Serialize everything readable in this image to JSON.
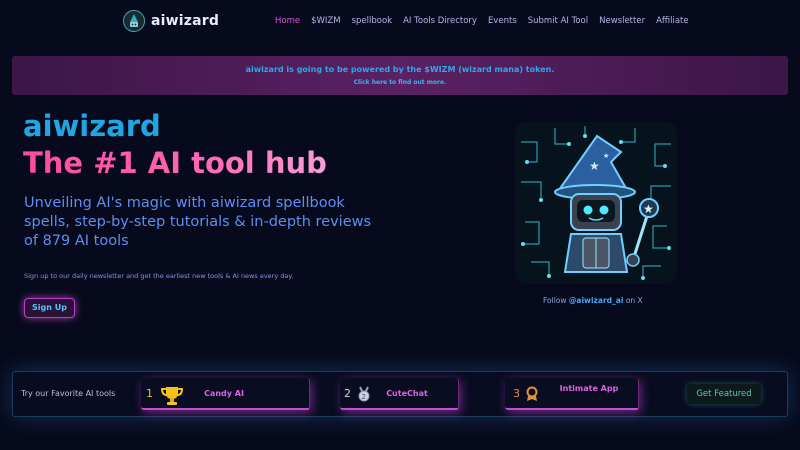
{
  "brand": {
    "name": "aiwizard"
  },
  "nav": {
    "links": [
      {
        "label": "Home",
        "active": true
      },
      {
        "label": "$WIZM",
        "active": false
      },
      {
        "label": "spellbook",
        "active": false
      },
      {
        "label": "AI Tools Directory",
        "active": false
      },
      {
        "label": "Events",
        "active": false
      },
      {
        "label": "Submit AI Tool",
        "active": false
      },
      {
        "label": "Newsletter",
        "active": false
      },
      {
        "label": "Affiliate",
        "active": false
      }
    ]
  },
  "banner": {
    "main": "aiwizard is going to be powered by the $WIZM (wizard mana) token.",
    "sub": "Click here to find out more."
  },
  "hero": {
    "title_line1": "aiwizard",
    "title_line2": "The #1 AI tool hub",
    "description": "Unveiling AI's magic with aiwizard spellbook spells, step-by-step tutorials & in-depth reviews of 879 AI tools",
    "newsletter_text": "Sign up to our daily newsletter and get the earliest new tools & AI news every day.",
    "signup_label": "Sign Up"
  },
  "follow": {
    "prefix": "Follow ",
    "handle": "@aiwizard_ai",
    "suffix": " on X"
  },
  "favorites": {
    "label": "Try our Favorite AI tools",
    "items": [
      {
        "rank": "1",
        "name": "Candy AI",
        "icon": "trophy-icon",
        "rank_color": "#f5c21a"
      },
      {
        "rank": "2",
        "name": "CuteChat",
        "icon": "silver-medal-icon",
        "rank_color": "#c9cfe0"
      },
      {
        "rank": "3",
        "name": "Intimate App",
        "icon": "bronze-medal-icon",
        "rank_color": "#e0923a"
      }
    ],
    "get_featured_label": "Get Featured"
  },
  "colors": {
    "background": "#070a1c",
    "accent_pink": "#ff4aa2",
    "accent_blue": "#20a7e3",
    "nav_active": "#d35ad6",
    "card_text": "#de62df"
  }
}
